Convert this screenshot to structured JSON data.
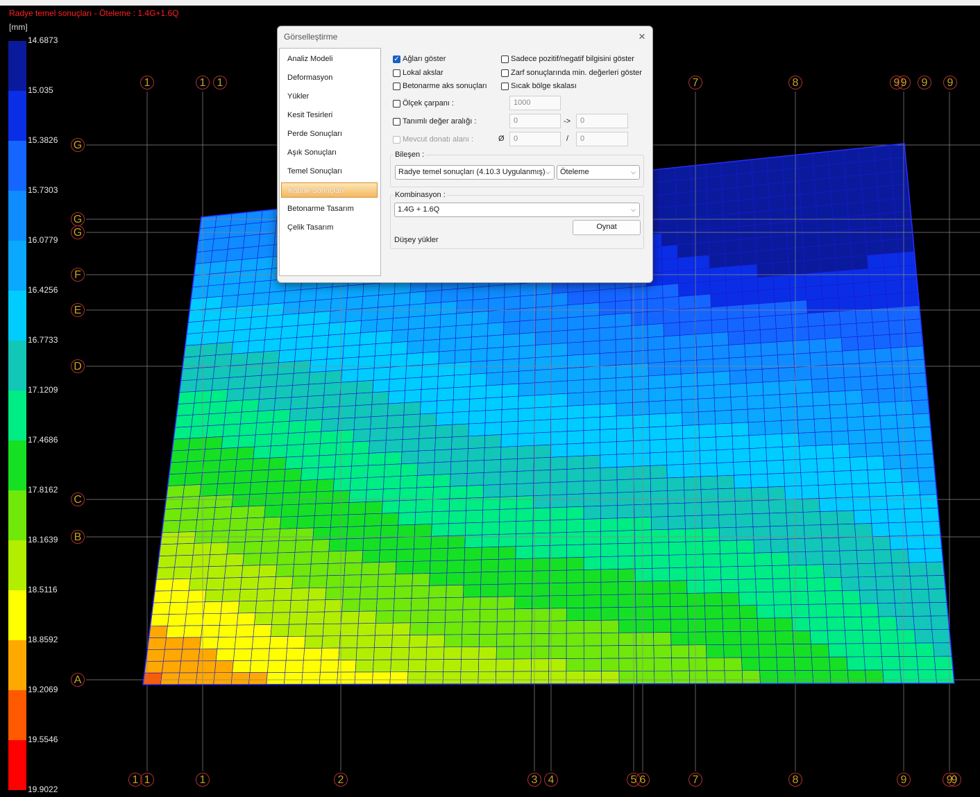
{
  "plot": {
    "title": "Radye temel sonuçları - Öteleme : 1.4G+1.6Q",
    "unit": "[mm]",
    "legend": [
      {
        "value": "14.6873",
        "color": "#0a1a9c"
      },
      {
        "value": "15.035",
        "color": "#0a2ee6"
      },
      {
        "value": "15.3826",
        "color": "#1466ff"
      },
      {
        "value": "15.7303",
        "color": "#0f8cff"
      },
      {
        "value": "16.0779",
        "color": "#0aa8ff"
      },
      {
        "value": "16.4256",
        "color": "#00ccff"
      },
      {
        "value": "16.7733",
        "color": "#12c6b8"
      },
      {
        "value": "17.1209",
        "color": "#00ec84"
      },
      {
        "value": "17.4686",
        "color": "#16e024"
      },
      {
        "value": "17.8162",
        "color": "#6fe80a"
      },
      {
        "value": "18.1639",
        "color": "#b2ee00"
      },
      {
        "value": "18.5116",
        "color": "#ffff00"
      },
      {
        "value": "18.8592",
        "color": "#ffa800"
      },
      {
        "value": "19.2069",
        "color": "#ff5a00"
      },
      {
        "value": "19.5546",
        "color": "#ff0000"
      },
      {
        "value": "19.9022",
        "color": "#e0086c"
      }
    ],
    "axes_left": [
      {
        "id": "G1",
        "label": "G"
      },
      {
        "id": "G2",
        "label": "G"
      },
      {
        "id": "G3",
        "label": "G"
      },
      {
        "id": "F",
        "label": "F"
      },
      {
        "id": "E",
        "label": "E"
      },
      {
        "id": "D",
        "label": "D"
      },
      {
        "id": "C",
        "label": "C"
      },
      {
        "id": "B",
        "label": "B"
      },
      {
        "id": "A",
        "label": "A"
      }
    ],
    "axes_top": [
      "1",
      "1",
      "1",
      "7",
      "8",
      "9",
      "9",
      "9",
      "9"
    ],
    "axes_bottom": [
      "1",
      "1",
      "1",
      "2",
      "3",
      "4",
      "5",
      "6",
      "7",
      "8",
      "9",
      "9",
      "9"
    ]
  },
  "dialog": {
    "title": "Görselleştirme",
    "close_symbol": "×",
    "nav": [
      {
        "label": "Analiz Modeli",
        "active": false
      },
      {
        "label": "Deformasyon",
        "active": false
      },
      {
        "label": "Yükler",
        "active": false
      },
      {
        "label": "Kesit Tesirleri",
        "active": false
      },
      {
        "label": "Perde Sonuçları",
        "active": false
      },
      {
        "label": "Aşık Sonuçları",
        "active": false
      },
      {
        "label": "Temel Sonuçları",
        "active": false
      },
      {
        "label": "Kabuk Sonuçları",
        "active": true
      },
      {
        "label": "Betonarme Tasarım",
        "active": false
      },
      {
        "label": "Çelik Tasarım",
        "active": false
      }
    ],
    "options": {
      "show_mesh": {
        "label": "Ağları göster",
        "checked": true
      },
      "local_axes": {
        "label": "Lokal akslar",
        "checked": false
      },
      "rc_axis_results": {
        "label": "Betonarme aks sonuçları",
        "checked": false
      },
      "only_pos_neg": {
        "label": "Sadece pozitif/negatif bilgisini göster",
        "checked": false
      },
      "envelope_min": {
        "label": "Zarf sonuçlarında min. değerleri göster",
        "checked": false
      },
      "heat_scale": {
        "label": "Sıcak bölge skalası",
        "checked": false
      },
      "scale_factor": {
        "label": "Ölçek çarpanı :",
        "checked": false,
        "value": "1000"
      },
      "defined_range": {
        "label": "Tanımlı değer aralığı :",
        "checked": false,
        "from": "0",
        "arrow": "->",
        "to": "0"
      },
      "existing_rebar": {
        "label": "Mevcut donatı alanı :",
        "checked": false,
        "disabled": true,
        "dia_symbol": "Ø",
        "dia": "0",
        "slash": "/",
        "spacing": "0"
      }
    },
    "component": {
      "label": "Bileşen :",
      "result_type": "Radye temel sonuçları (4.10.3 Uygulanmış)",
      "quantity": "Öteleme"
    },
    "combination": {
      "label": "Kombinasyon :",
      "value": "1.4G + 1.6Q",
      "play_button": "Oynat",
      "description": "Düşey yükler"
    }
  }
}
